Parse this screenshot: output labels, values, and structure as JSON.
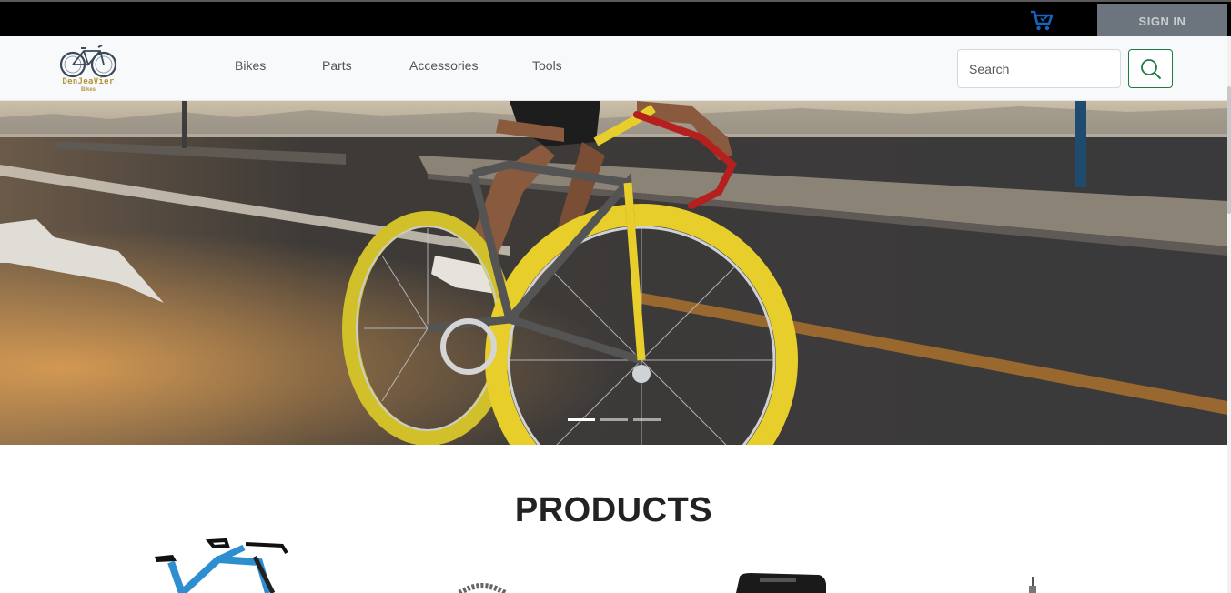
{
  "topbar": {
    "cart_icon": "cart-icon",
    "signin_label": "SIGN IN"
  },
  "brand": {
    "name": "DenJeaVier",
    "tagline": "Bikes"
  },
  "nav": {
    "links": [
      {
        "label": "Bikes"
      },
      {
        "label": "Parts"
      },
      {
        "label": "Accessories"
      },
      {
        "label": "Tools"
      }
    ]
  },
  "search": {
    "placeholder": "Search",
    "button_icon": "search-icon"
  },
  "carousel": {
    "slide_count": 3,
    "active_index": 0
  },
  "products": {
    "title": "PRODUCTS"
  },
  "colors": {
    "topbar_bg": "#000000",
    "signin_bg": "#6c757d",
    "navbar_bg": "#f8f9fa",
    "brand_gold": "#b4963e",
    "search_accent": "#1f7a46",
    "cart_blue": "#1565c0"
  }
}
